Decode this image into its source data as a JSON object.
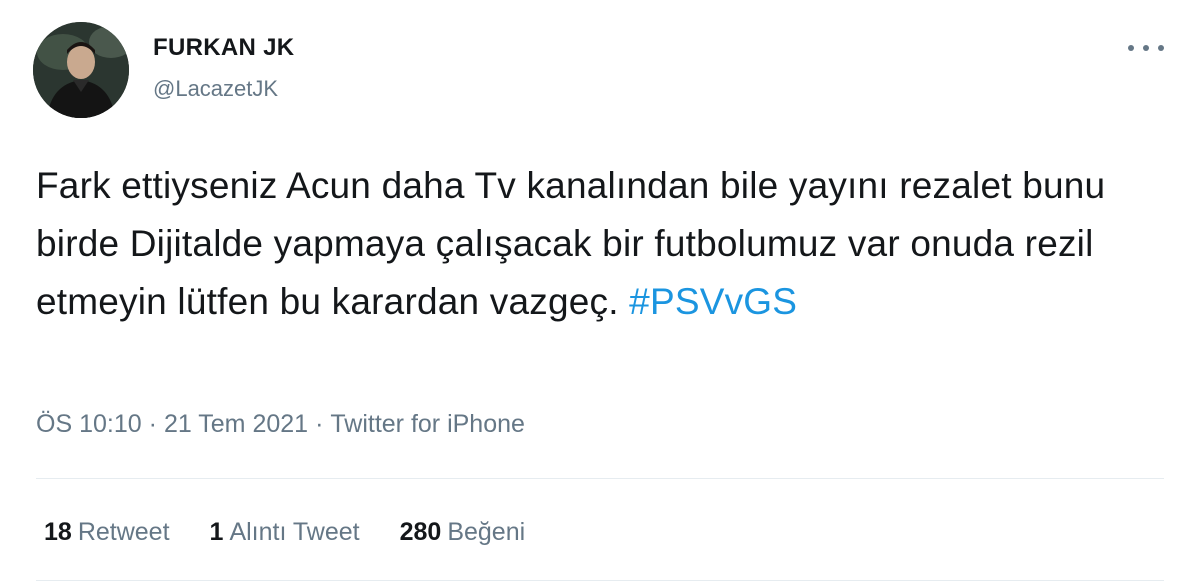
{
  "author": {
    "name": "FURKAN JK",
    "handle": "@LacazetJK"
  },
  "tweet": {
    "text_before": "Fark ettiyseniz Acun daha Tv kanalından bile yayını rezalet bunu birde Dijitalde yapmaya çalışacak bir futbolumuz var onuda rezil etmeyin lütfen bu karardan vazgeç. ",
    "hashtag": "#PSVvGS"
  },
  "meta": {
    "time": "ÖS 10:10",
    "separator": "·",
    "date": "21 Tem 2021",
    "source": "Twitter for iPhone"
  },
  "stats": {
    "retweets_count": "18",
    "retweets_label": "Retweet",
    "quotes_count": "1",
    "quotes_label": "Alıntı Tweet",
    "likes_count": "280",
    "likes_label": "Beğeni"
  },
  "colors": {
    "link": "#1b95e0",
    "secondary_text": "#657786",
    "primary_text": "#14171a"
  },
  "icons": {
    "more": "more-horizontal-icon"
  }
}
